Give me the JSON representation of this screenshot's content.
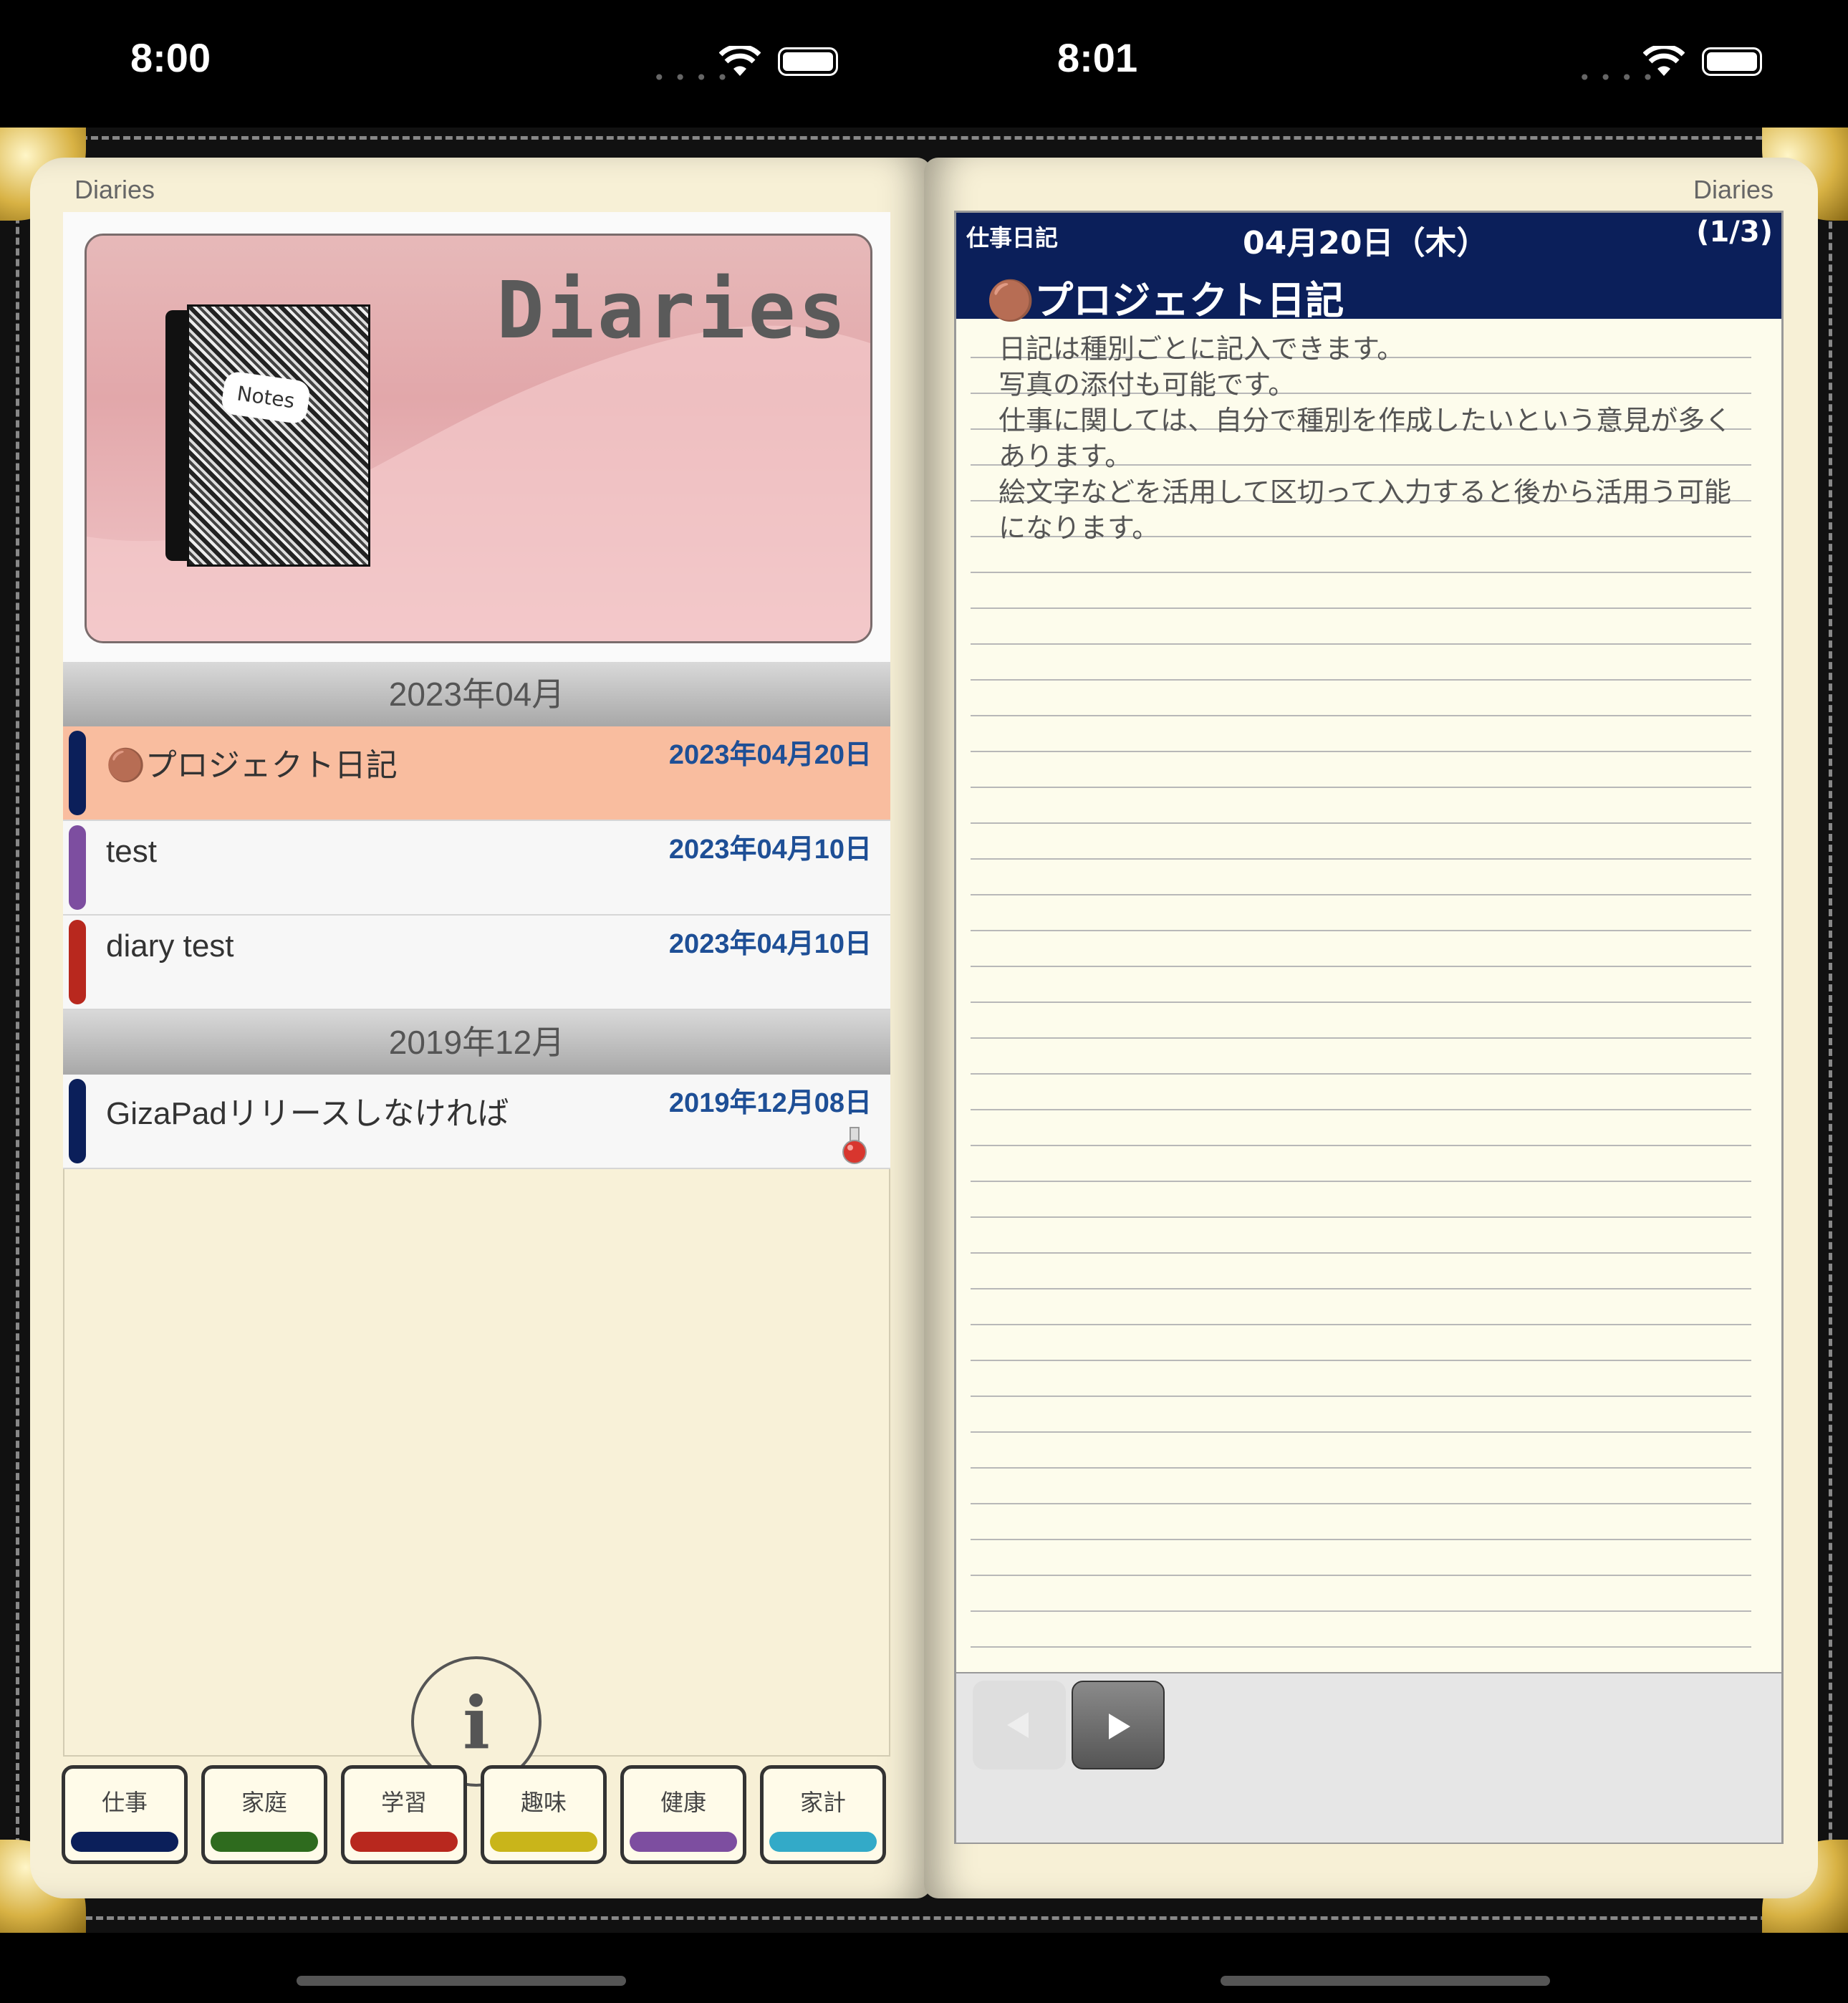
{
  "status_left": {
    "time": "8:00"
  },
  "status_right": {
    "time": "8:01"
  },
  "app_title": "Diaries",
  "banner": {
    "title": "Diaries",
    "notebook_label": "Notes"
  },
  "sections": [
    {
      "label": "2023年04月"
    },
    {
      "label": "2019年12月"
    }
  ],
  "entries": [
    {
      "title": "🟤プロジェクト日記",
      "date": "2023年04月20日",
      "color": "#0b1f5a",
      "selected": true
    },
    {
      "title": "test",
      "date": "2023年04月10日",
      "color": "#7d4ea0"
    },
    {
      "title": "diary test",
      "date": "2023年04月10日",
      "color": "#b8281e"
    },
    {
      "title": "GizaPadリリースしなければ",
      "date": "2019年12月08日",
      "color": "#0b1f5a",
      "icon": "potion-flask-icon"
    }
  ],
  "info_button": {
    "label": "i"
  },
  "category_tabs": [
    {
      "label": "仕事",
      "color": "#0b1f5a"
    },
    {
      "label": "家庭",
      "color": "#2e6b1e"
    },
    {
      "label": "学習",
      "color": "#b8281e"
    },
    {
      "label": "趣味",
      "color": "#c9b51a"
    },
    {
      "label": "健康",
      "color": "#7d4ea0"
    },
    {
      "label": "家計",
      "color": "#33aac8"
    }
  ],
  "diary_page": {
    "category": "仕事日記",
    "date": "04月20日（木）",
    "page": "(1/3)",
    "title": "🟤プロジェクト日記",
    "body": [
      "日記は種別ごとに記入できます。",
      "写真の添付も可能です。",
      "仕事に関しては、自分で種別を作成したいという意見が多く",
      "あります。",
      "絵文字などを活用して区切って入力すると後から活用う可能",
      "になります。"
    ]
  },
  "nav": {
    "prev_icon": "prev-triangle-icon",
    "next_icon": "next-triangle-icon"
  },
  "colors": {
    "accent_navy": "#0b1f5a",
    "date_blue": "#1e4f96",
    "selected_row": "#f9bd9f",
    "paper": "#f7f0d6"
  }
}
